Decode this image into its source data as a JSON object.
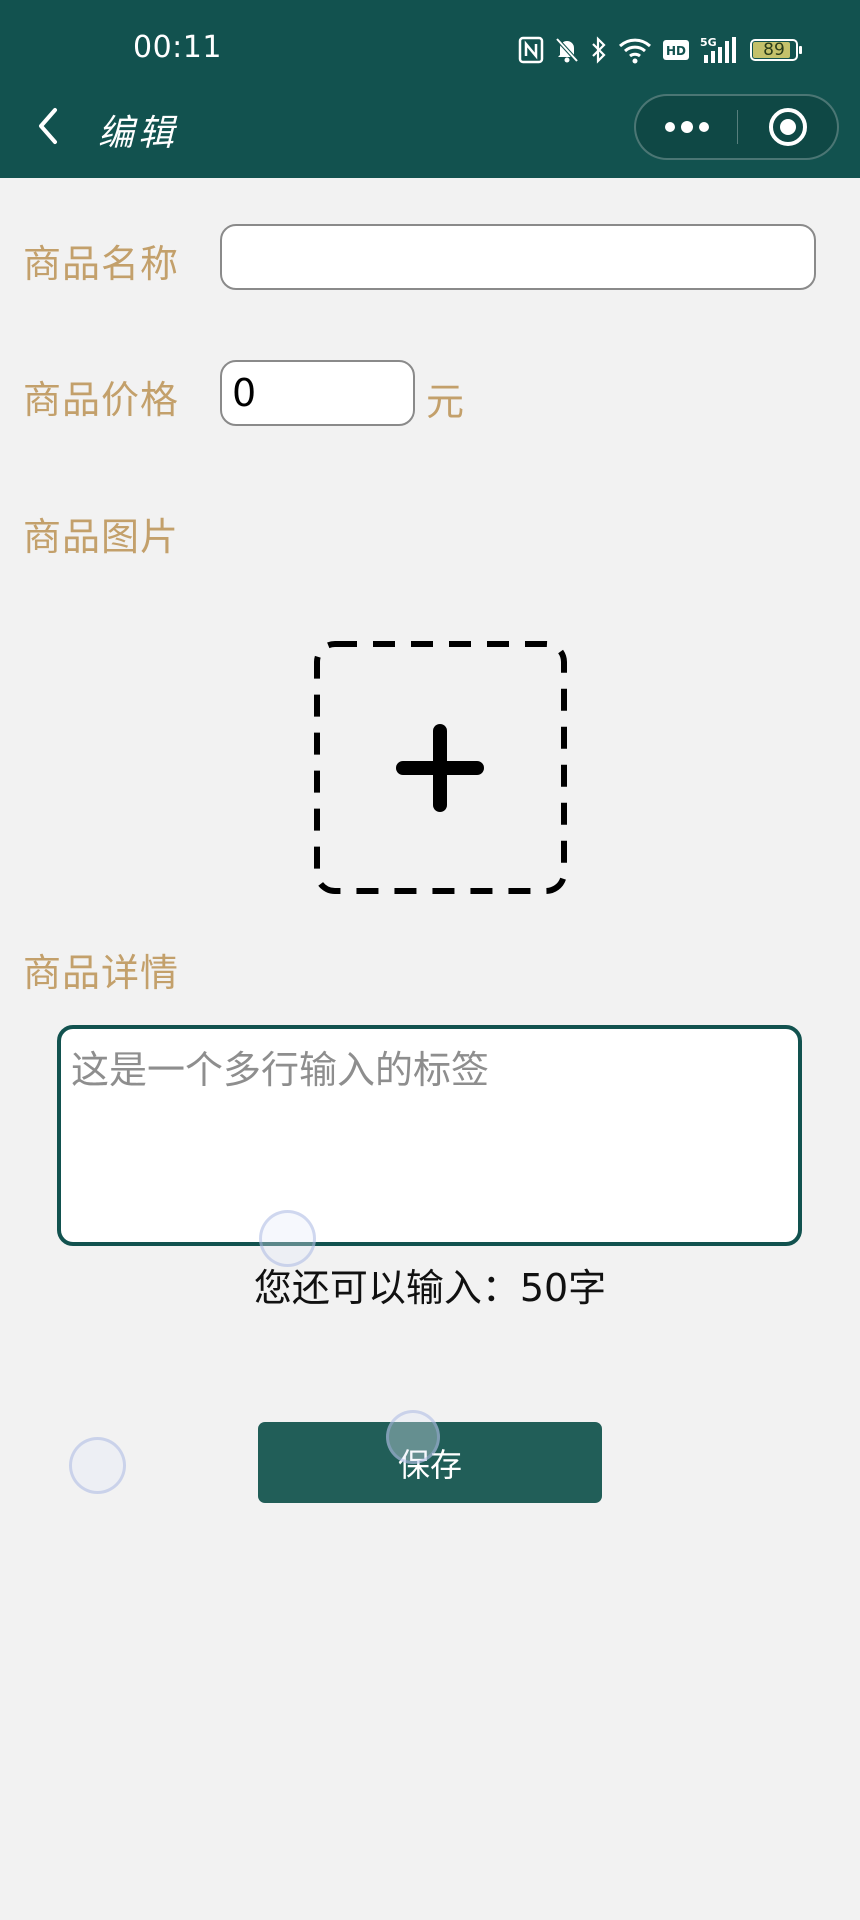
{
  "status_bar": {
    "time": "00:11",
    "battery_level": "89",
    "battery_percent": 89,
    "icons": [
      "nfc-icon",
      "bell-muted-icon",
      "bluetooth-icon",
      "wifi-icon",
      "hd-icon",
      "5g-signal-icon",
      "battery-icon"
    ]
  },
  "nav_bar": {
    "title": "编辑",
    "back_icon": "chevron-left-icon",
    "menu_icon": "more-dots-icon",
    "close_icon": "target-circle-icon"
  },
  "form": {
    "name_label": "商品名称",
    "name_value": "",
    "price_label": "商品价格",
    "price_value": "0",
    "price_unit": "元",
    "image_label": "商品图片",
    "upload_icon": "plus-icon",
    "detail_label": "商品详情",
    "detail_placeholder": "这是一个多行输入的标签",
    "counter_text": "您还可以输入：50字"
  },
  "actions": {
    "save_label": "保存"
  },
  "colors": {
    "header_bg": "#12524f",
    "label_color": "#c3a06b",
    "button_bg": "#215e58",
    "page_bg": "#f2f2f2"
  }
}
